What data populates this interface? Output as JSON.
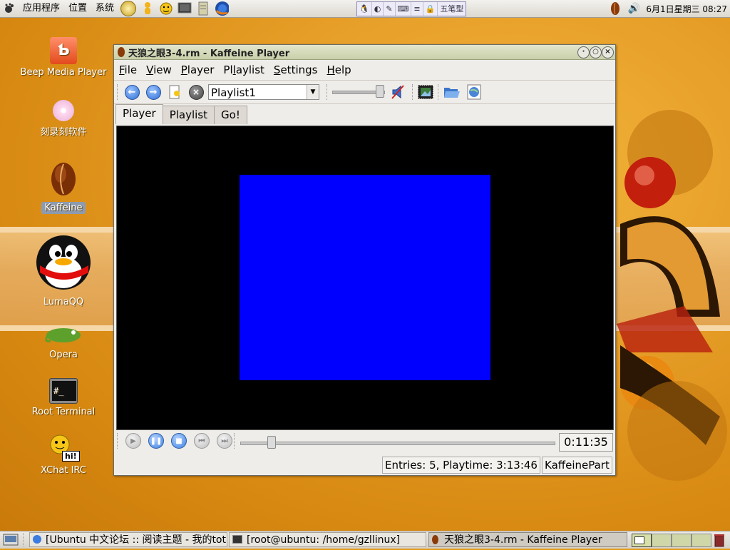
{
  "top_panel": {
    "menus": [
      "应用程序",
      "位置",
      "系统"
    ],
    "launchers": [
      "help-icon",
      "gaim-icon",
      "xchat-face-icon",
      "terminal-icon",
      "text-editor-icon",
      "firefox-icon"
    ],
    "im_bar": [
      "五笔型"
    ],
    "clock": "6月1日星期三 08:27"
  },
  "desktop": {
    "icons": [
      {
        "label": "Beep Media Player",
        "icon": "bmp-icon"
      },
      {
        "label": "刻录刻软件",
        "icon": "cd-burner-icon"
      },
      {
        "label": "Kaffeine",
        "icon": "kaffeine-bean-icon"
      },
      {
        "label": "LumaQQ",
        "icon": "penguin-icon"
      },
      {
        "label": "Opera",
        "icon": "chameleon-icon"
      },
      {
        "label": "Root Terminal",
        "icon": "terminal-icon"
      },
      {
        "label": "XChat IRC",
        "icon": "xchat-icon"
      }
    ],
    "xchat_badge": "hi!"
  },
  "window": {
    "title": "天狼之眼3-4.rm - Kaffeine Player",
    "menu": [
      "File",
      "View",
      "Player",
      "Playlist",
      "Settings",
      "Help"
    ],
    "menu_accel": [
      "F",
      "V",
      "P",
      "l",
      "S",
      "H"
    ],
    "menu_rest": [
      "ile",
      "iew",
      "layer",
      "aylist",
      "ettings",
      "elp"
    ],
    "menu_prefix": [
      "",
      "",
      "",
      "Pl",
      "",
      ""
    ],
    "playlist_combo": "Playlist1",
    "volume_fraction": 0.9,
    "tabs": [
      "Player",
      "Playlist",
      "Go!"
    ],
    "active_tab": "Player",
    "seek_fraction": 0.1,
    "elapsed": "0:11:35",
    "status_entries": "Entries: 5, Playtime: 3:13:46",
    "status_part": "KaffeinePart",
    "video_color": "#0000ff"
  },
  "taskbar": {
    "tasks": [
      {
        "label": "[Ubuntu 中文论坛 :: 阅读主题 - 我的tot···",
        "icon": "firefox-icon"
      },
      {
        "label": "[root@ubuntu: /home/gzllinux]",
        "icon": "terminal-icon"
      },
      {
        "label": "天狼之眼3-4.rm - Kaffeine Player",
        "icon": "kaffeine-bean-icon"
      }
    ]
  }
}
